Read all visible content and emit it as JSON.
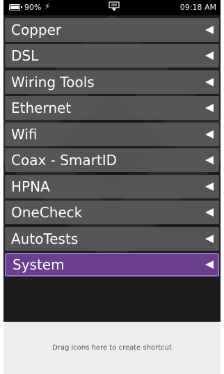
{
  "status": {
    "battery_percent": "90%",
    "charging_icon": "lightning-bolt-icon",
    "notification_icon": "notification-tray-icon",
    "time": "09:18 AM"
  },
  "menu": {
    "items": [
      {
        "label": "Copper",
        "icon": "arrow-left-icon"
      },
      {
        "label": "DSL",
        "icon": "arrow-left-icon"
      },
      {
        "label": "Wiring Tools",
        "icon": "arrow-left-icon"
      },
      {
        "label": "Ethernet",
        "icon": "arrow-left-icon"
      },
      {
        "label": "Wifi",
        "icon": "arrow-left-icon"
      },
      {
        "label": "Coax - SmartID",
        "icon": "arrow-left-icon"
      },
      {
        "label": "HPNA",
        "icon": "arrow-left-icon"
      },
      {
        "label": "OneCheck",
        "icon": "arrow-left-icon"
      },
      {
        "label": "AutoTests",
        "icon": "arrow-left-icon"
      },
      {
        "label": "System",
        "icon": "arrow-left-icon",
        "selected": true
      }
    ]
  },
  "shortcut_area": {
    "hint": "Drag icons here to create shortcut"
  },
  "colors": {
    "menu_item_bg": "#5a5a5a",
    "selected_bg": "#6a3f8e",
    "selected_border": "#9a6fc4",
    "screen_bg": "#1c1c1c",
    "shortcut_bg": "#ededed"
  }
}
